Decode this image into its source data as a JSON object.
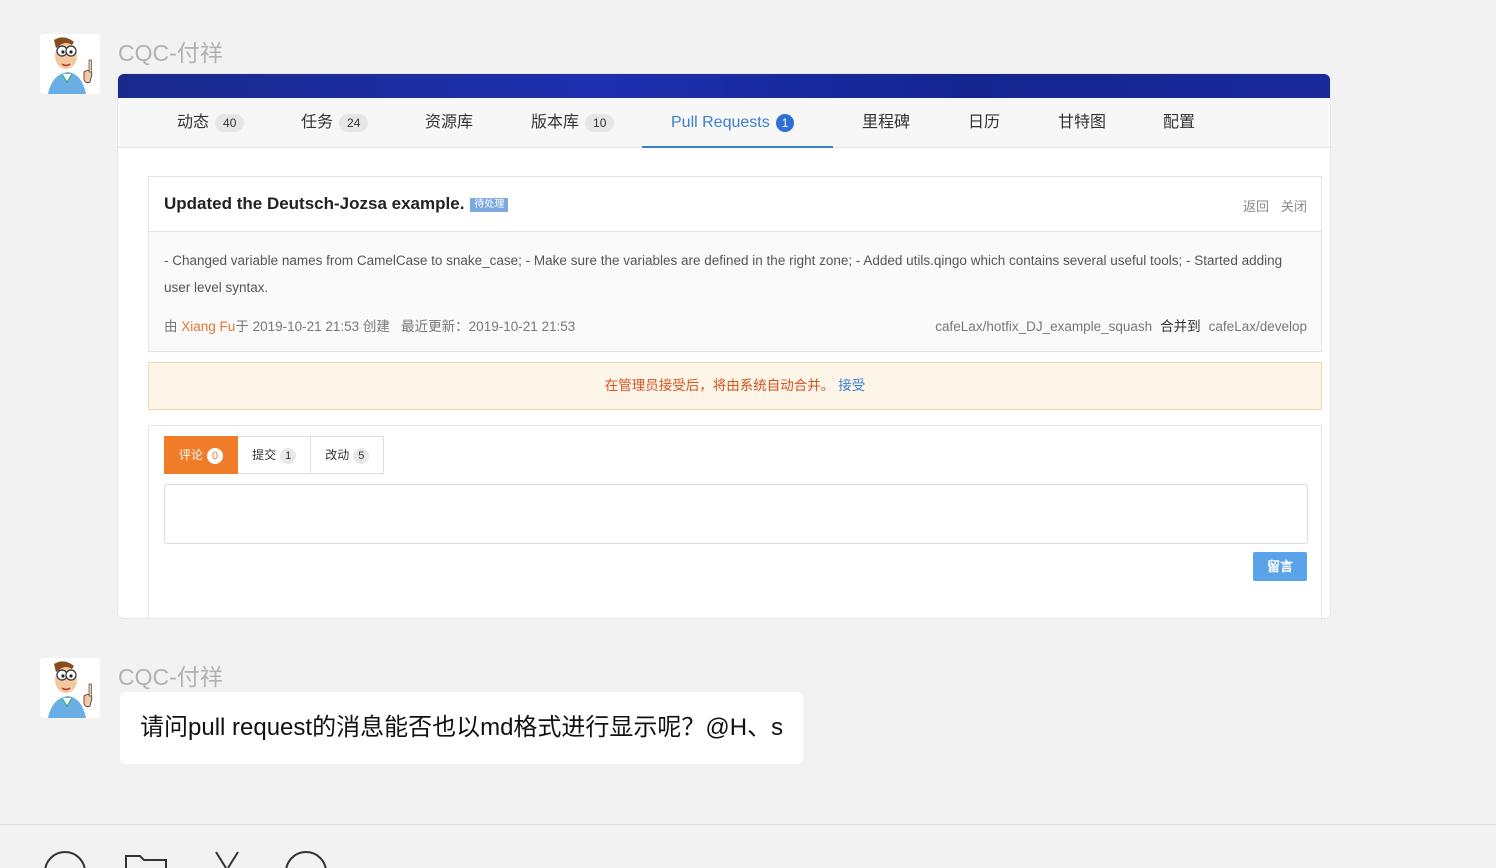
{
  "messages": [
    {
      "sender": "CQC-付祥",
      "type": "image"
    },
    {
      "sender": "CQC-付祥",
      "type": "text",
      "text": "请问pull request的消息能否也以md格式进行显示呢？@H、s"
    }
  ],
  "shot": {
    "nav": [
      {
        "label": "动态",
        "count": "40"
      },
      {
        "label": "任务",
        "count": "24"
      },
      {
        "label": "资源库",
        "count": ""
      },
      {
        "label": "版本库",
        "count": "10"
      },
      {
        "label": "Pull Requests",
        "count": "1"
      },
      {
        "label": "里程碑",
        "count": ""
      },
      {
        "label": "日历",
        "count": ""
      },
      {
        "label": "甘特图",
        "count": ""
      },
      {
        "label": "配置",
        "count": ""
      }
    ],
    "active_tab": "Pull Requests",
    "pr": {
      "title": "Updated the Deutsch-Jozsa example.",
      "status": "待处理",
      "back": "返回",
      "close": "关闭",
      "description": "- Changed variable names from CamelCase to snake_case; - Make sure the variables are defined in the right zone; - Added utils.qingo which contains several useful tools; - Started adding user level syntax.",
      "by": "由",
      "author": "Xiang Fu",
      "created": "于 2019-10-21 21:53 创建",
      "updated": "最近更新：2019-10-21 21:53",
      "source_branch": "cafeLax/hotfix_DJ_example_squash",
      "merge_into": "合并到",
      "target_branch": "cafeLax/develop"
    },
    "notice": {
      "text": "在管理员接受后，将由系统自动合并。",
      "accept": "接受"
    },
    "comment_tabs": [
      {
        "label": "评论",
        "count": "0"
      },
      {
        "label": "提交",
        "count": "1"
      },
      {
        "label": "改动",
        "count": "5"
      }
    ],
    "comment_button": "留言"
  },
  "colors": {
    "accent_blue": "#3b7fd1",
    "accent_orange": "#f07c2a",
    "banner": "#1d2fb0"
  },
  "toolbar": [
    "emoji-icon",
    "folder-icon",
    "scissors-icon",
    "chat-icon"
  ]
}
